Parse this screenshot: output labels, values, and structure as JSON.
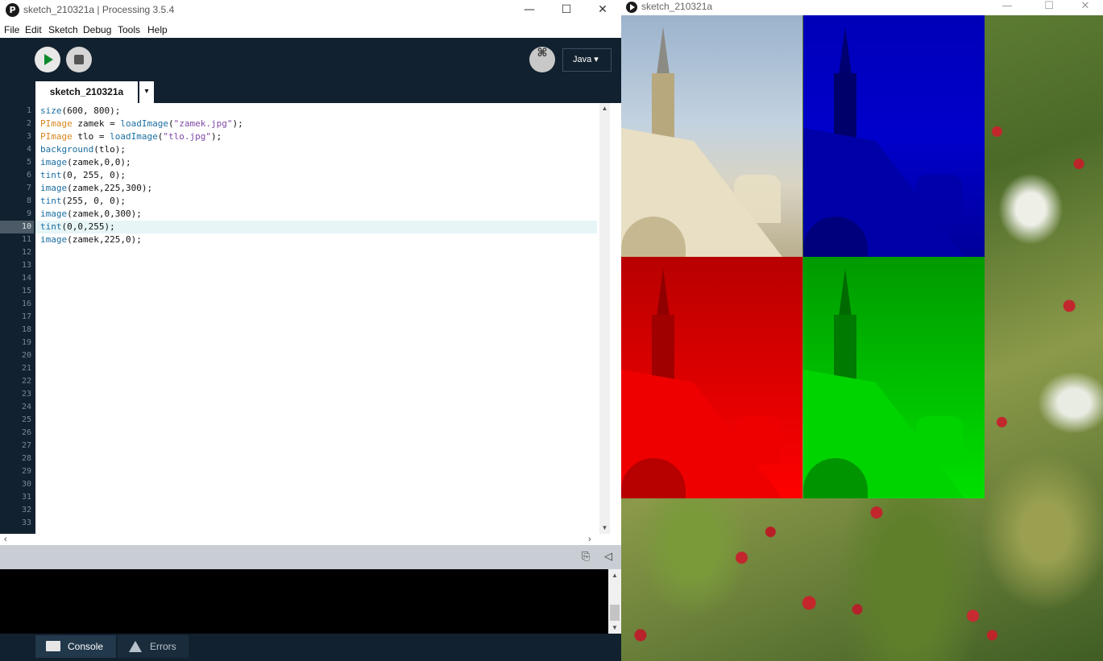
{
  "ide": {
    "window_title": "sketch_210321a | Processing 3.5.4",
    "logo_glyph": "P",
    "window_controls": {
      "minimize": "—",
      "maximize": "☐",
      "close": "✕"
    },
    "menu": [
      "File",
      "Edit",
      "Sketch",
      "Debug",
      "Tools",
      "Help"
    ],
    "toolbar": {
      "debug_glyph": "⌘",
      "mode": "Java ▾"
    },
    "tab": {
      "name": "sketch_210321a",
      "menu_glyph": "▾"
    },
    "current_line": 10,
    "line_numbers": [
      "1",
      "2",
      "3",
      "4",
      "5",
      "6",
      "7",
      "8",
      "9",
      "10",
      "11",
      "12",
      "13",
      "14",
      "15",
      "16",
      "17",
      "18",
      "19",
      "20",
      "21",
      "22",
      "23",
      "24",
      "25",
      "26",
      "27",
      "28",
      "29",
      "30",
      "31",
      "32",
      "33"
    ],
    "code": [
      [
        {
          "t": "size",
          "c": "fn"
        },
        {
          "t": "(600, 800);"
        }
      ],
      [
        {
          "t": "PImage",
          "c": "ty"
        },
        {
          "t": " zamek = "
        },
        {
          "t": "loadImage",
          "c": "fn"
        },
        {
          "t": "("
        },
        {
          "t": "\"zamek.jpg\"",
          "c": "str"
        },
        {
          "t": ");"
        }
      ],
      [
        {
          "t": "PImage",
          "c": "ty"
        },
        {
          "t": " tlo = "
        },
        {
          "t": "loadImage",
          "c": "fn"
        },
        {
          "t": "("
        },
        {
          "t": "\"tlo.jpg\"",
          "c": "str"
        },
        {
          "t": ");"
        }
      ],
      [
        {
          "t": "background",
          "c": "fn"
        },
        {
          "t": "(tlo);"
        }
      ],
      [
        {
          "t": "image",
          "c": "fn"
        },
        {
          "t": "(zamek,0,0);"
        }
      ],
      [
        {
          "t": "tint",
          "c": "fn"
        },
        {
          "t": "(0, 255, 0);"
        }
      ],
      [
        {
          "t": "image",
          "c": "fn"
        },
        {
          "t": "(zamek,225,300);"
        }
      ],
      [
        {
          "t": "tint",
          "c": "fn"
        },
        {
          "t": "(255, 0, 0);"
        }
      ],
      [
        {
          "t": "image",
          "c": "fn"
        },
        {
          "t": "(zamek,0,300);"
        }
      ],
      [
        {
          "t": "tint",
          "c": "fn"
        },
        {
          "t": "(0,0,255);"
        }
      ],
      [
        {
          "t": "image",
          "c": "fn"
        },
        {
          "t": "(zamek,225,0);"
        }
      ]
    ],
    "console_tabs": {
      "console": "Console",
      "errors": "Errors"
    }
  },
  "sketch_window": {
    "title": "sketch_210321a",
    "window_controls": {
      "minimize": "—",
      "maximize": "☐",
      "close": "✕"
    },
    "quadrants": [
      {
        "name": "original",
        "color": "#c9c2a8"
      },
      {
        "name": "blue-tint",
        "color": "#0000cc"
      },
      {
        "name": "red-tint",
        "color": "#ff0000"
      },
      {
        "name": "green-tint",
        "color": "#00cc00"
      }
    ]
  },
  "colors": {
    "toolbar_bg": "#12212f",
    "run_green": "#0b8a2b",
    "keyword_blue": "#1a6da0",
    "type_orange": "#d9861e",
    "string_purple": "#7e47a6"
  }
}
